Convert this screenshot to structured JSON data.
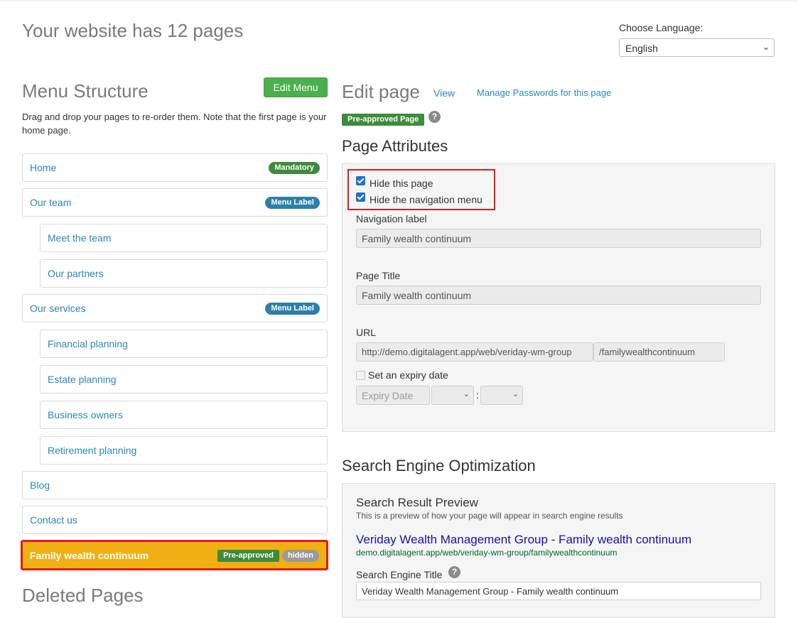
{
  "header": {
    "site_title": "Your website has 12 pages",
    "language_label": "Choose Language:",
    "language_value": "English"
  },
  "menu": {
    "heading": "Menu Structure",
    "edit_button": "Edit Menu",
    "description": "Drag and drop your pages to re-order them. Note that the first page is your home page.",
    "items": [
      {
        "label": "Home",
        "badge": "Mandatory"
      },
      {
        "label": "Our team",
        "badge": "Menu Label"
      },
      {
        "label": "Meet the team"
      },
      {
        "label": "Our partners"
      },
      {
        "label": "Our services",
        "badge": "Menu Label"
      },
      {
        "label": "Financial planning"
      },
      {
        "label": "Estate planning"
      },
      {
        "label": "Business owners"
      },
      {
        "label": "Retirement planning"
      },
      {
        "label": "Blog"
      },
      {
        "label": "Contact us"
      },
      {
        "label": "Family wealth continuum",
        "badge": "Pre-approved",
        "badge2": "hidden"
      }
    ],
    "deleted_heading": "Deleted Pages"
  },
  "edit": {
    "heading": "Edit page",
    "view_link": "View",
    "manage_link": "Manage Passwords for this page",
    "status_badge": "Pre-approved Page",
    "help": "?"
  },
  "attributes": {
    "heading": "Page Attributes",
    "hide_page_label": "Hide this page",
    "hide_page_checked": true,
    "hide_nav_label": "Hide the navigation menu",
    "hide_nav_checked": true,
    "nav_label_label": "Navigation label",
    "nav_label_value": "Family wealth continuum",
    "page_title_label": "Page Title",
    "page_title_value": "Family wealth continuum",
    "url_label": "URL",
    "url_prefix": "http://demo.digitalagent.app/web/veriday-wm-group",
    "url_slug": "/familywealthcontinuum",
    "expiry_label": "Set an expiry date",
    "expiry_checked": false,
    "expiry_placeholder": "Expiry Date",
    "time_separator": ":"
  },
  "seo": {
    "heading": "Search Engine Optimization",
    "preview_title": "Search Result Preview",
    "preview_desc": "This is a preview of how your page will appear in search engine results",
    "preview_link": "Veriday Wealth Management Group - Family wealth continuum",
    "preview_url": "demo.digitalagent.app/web/veriday-wm-group/familywealthcontinuum",
    "se_title_label": "Search Engine Title",
    "se_title_value": "Veriday Wealth Management Group - Family wealth continuum"
  },
  "colors": {
    "accent_link": "#2a87b6",
    "selected_item_bg": "#f0b013",
    "highlight_border": "#e01b1b",
    "badge_green": "#3d8b3d",
    "badge_blue": "#2e7fa8"
  }
}
